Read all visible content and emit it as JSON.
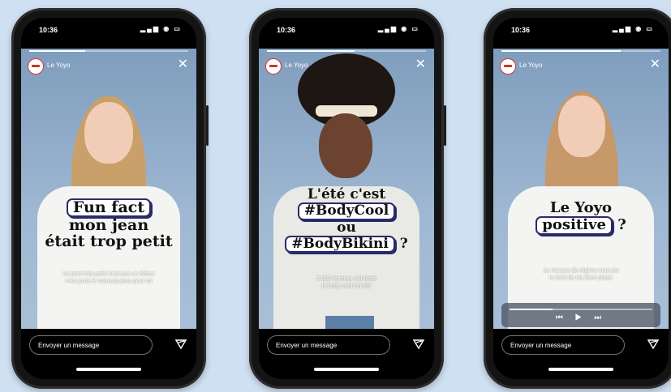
{
  "phones": [
    {
      "time": "10:36",
      "account": "Le Yoyo",
      "caption": [
        "Fun fact",
        "mon jean",
        "était trop petit"
      ],
      "subtitle": [
        "Un jean trop petit n'est pas un échec",
        "c'est juste le mauvais jean pour toi"
      ],
      "message_placeholder": "Envoyer un message"
    },
    {
      "time": "10:36",
      "account": "Le Yoyo",
      "caption": [
        "L'été c'est",
        "#BodyCool",
        "ou",
        "#BodyBikini",
        "?"
      ],
      "subtitle": [
        "2 000 femmes ont testé",
        "le body cool cet été"
      ],
      "message_placeholder": "Envoyer un message"
    },
    {
      "time": "10:36",
      "account": "Le Yoyo",
      "caption": [
        "Le Yoyo",
        "positive",
        "?"
      ],
      "subtitle": [
        "Je n'ai pas de régime mais j'ai",
        "le droit de me faire plaisir"
      ],
      "message_placeholder": "Envoyer un message"
    }
  ],
  "colors": {
    "background": "#cfe0f2",
    "caption_border": "#2a2a6a",
    "photo_bg": "#9fb8d3"
  },
  "icons": {
    "close": "✕",
    "status": "▂▄▆ ◉ ▭",
    "player": "⏮ ▶ ⏭"
  }
}
